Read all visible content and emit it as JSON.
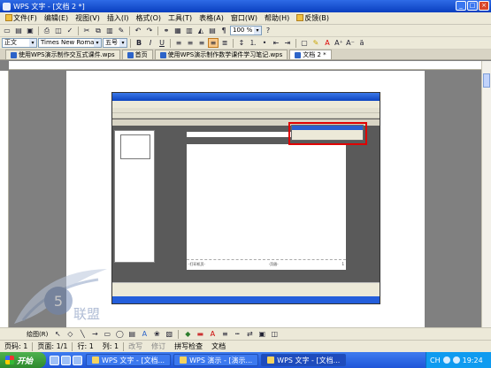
{
  "window": {
    "title": "WPS 文字 - [文档 2 *]",
    "controls": [
      "_",
      "□",
      "×"
    ]
  },
  "menubar": {
    "items": [
      "文件(F)",
      "编辑(E)",
      "视图(V)",
      "插入(I)",
      "格式(O)",
      "工具(T)",
      "表格(A)",
      "窗口(W)",
      "帮助(H)",
      "反馈(B)"
    ]
  },
  "toolbar1": {
    "zoom": "100 %"
  },
  "toolbar2": {
    "style": "正文",
    "font": "Times New Roman",
    "size": "五号",
    "bold": "B",
    "italic": "I",
    "underline": "U"
  },
  "tabs": [
    {
      "label": "使用WPS演示制作交互式课件.wps",
      "active": false
    },
    {
      "label": "首页",
      "active": false
    },
    {
      "label": "使用WPS演示制作数学课件学习笔记.wps",
      "active": false
    },
    {
      "label": "文档 2 *",
      "active": true
    }
  ],
  "embedded_shot": {
    "footer_left": "-打印机页-",
    "footer_mid": "-页眉-",
    "footer_right": "1"
  },
  "statusbar": {
    "page": "页码: 1",
    "section": "页面: 1/1",
    "row": "行: 1",
    "col": "列: 1",
    "mode1": "改写",
    "mode2": "修订",
    "mode3": "拼写检查",
    "mode4": "文档"
  },
  "drawbar": {
    "label": "绘图(R)"
  },
  "taskbar": {
    "start": "开始",
    "tasks": [
      {
        "label": "WPS 文字 - [文档...",
        "active": false
      },
      {
        "label": "WPS 演示 - [演示...",
        "active": false
      },
      {
        "label": "WPS 文字 - [文档...",
        "active": true
      }
    ],
    "ime": "CH",
    "clock": "19:24"
  },
  "watermark": {
    "text": "联盟"
  }
}
